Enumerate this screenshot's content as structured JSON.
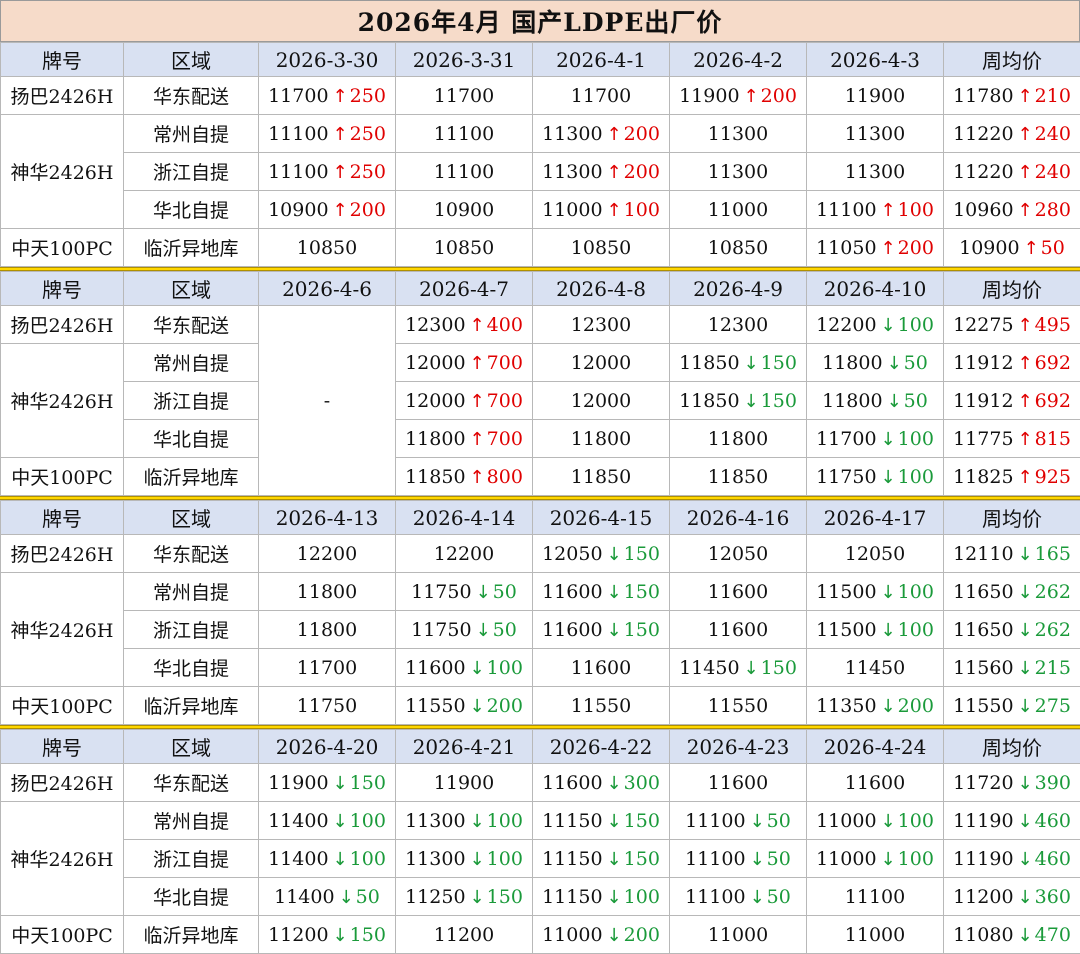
{
  "title": "2026年4月  国产LDPE出厂价",
  "colors": {
    "up": "#e00000",
    "down": "#1a9a3a",
    "header_bg": "#d9e1f2",
    "title_bg": "#f6dbc9",
    "separator": "#ffd700"
  },
  "icons": {
    "up": "arrow-up-icon",
    "down": "arrow-down-icon"
  },
  "header_labels": {
    "brand": "牌号",
    "region": "区域",
    "avg": "周均价"
  },
  "weeks": [
    {
      "dates": [
        "2026-3-30",
        "2026-3-31",
        "2026-4-1",
        "2026-4-2",
        "2026-4-3"
      ],
      "rows": [
        {
          "brand": "扬巴2426H",
          "region": "华东配送",
          "cells": [
            {
              "v": "11700",
              "dir": "up",
              "chg": "250"
            },
            {
              "v": "11700"
            },
            {
              "v": "11700"
            },
            {
              "v": "11900",
              "dir": "up",
              "chg": "200"
            },
            {
              "v": "11900"
            },
            {
              "v": "11780",
              "dir": "up",
              "chg": "210"
            }
          ]
        },
        {
          "brand": "神华2426H",
          "region": "常州自提",
          "cells": [
            {
              "v": "11100",
              "dir": "up",
              "chg": "250"
            },
            {
              "v": "11100"
            },
            {
              "v": "11300",
              "dir": "up",
              "chg": "200"
            },
            {
              "v": "11300"
            },
            {
              "v": "11300"
            },
            {
              "v": "11220",
              "dir": "up",
              "chg": "240"
            }
          ]
        },
        {
          "brand": "",
          "region": "浙江自提",
          "cells": [
            {
              "v": "11100",
              "dir": "up",
              "chg": "250"
            },
            {
              "v": "11100"
            },
            {
              "v": "11300",
              "dir": "up",
              "chg": "200"
            },
            {
              "v": "11300"
            },
            {
              "v": "11300"
            },
            {
              "v": "11220",
              "dir": "up",
              "chg": "240"
            }
          ]
        },
        {
          "brand": "",
          "region": "华北自提",
          "cells": [
            {
              "v": "10900",
              "dir": "up",
              "chg": "200"
            },
            {
              "v": "10900"
            },
            {
              "v": "11000",
              "dir": "up",
              "chg": "100"
            },
            {
              "v": "11000"
            },
            {
              "v": "11100",
              "dir": "up",
              "chg": "100"
            },
            {
              "v": "10960",
              "dir": "up",
              "chg": "280"
            }
          ]
        },
        {
          "brand": "中天100PC",
          "region": "临沂异地库",
          "cells": [
            {
              "v": "10850"
            },
            {
              "v": "10850"
            },
            {
              "v": "10850"
            },
            {
              "v": "10850"
            },
            {
              "v": "11050",
              "dir": "up",
              "chg": "200"
            },
            {
              "v": "10900",
              "dir": "up",
              "chg": "50"
            }
          ]
        }
      ]
    },
    {
      "dates": [
        "2026-4-6",
        "2026-4-7",
        "2026-4-8",
        "2026-4-9",
        "2026-4-10"
      ],
      "holiday_mark": "-",
      "rows": [
        {
          "brand": "扬巴2426H",
          "region": "华东配送",
          "cells": [
            null,
            {
              "v": "12300",
              "dir": "up",
              "chg": "400"
            },
            {
              "v": "12300"
            },
            {
              "v": "12300"
            },
            {
              "v": "12200",
              "dir": "down",
              "chg": "100"
            },
            {
              "v": "12275",
              "dir": "up",
              "chg": "495"
            }
          ]
        },
        {
          "brand": "神华2426H",
          "region": "常州自提",
          "cells": [
            null,
            {
              "v": "12000",
              "dir": "up",
              "chg": "700"
            },
            {
              "v": "12000"
            },
            {
              "v": "11850",
              "dir": "down",
              "chg": "150"
            },
            {
              "v": "11800",
              "dir": "down",
              "chg": "50"
            },
            {
              "v": "11912",
              "dir": "up",
              "chg": "692"
            }
          ]
        },
        {
          "brand": "",
          "region": "浙江自提",
          "cells": [
            null,
            {
              "v": "12000",
              "dir": "up",
              "chg": "700"
            },
            {
              "v": "12000"
            },
            {
              "v": "11850",
              "dir": "down",
              "chg": "150"
            },
            {
              "v": "11800",
              "dir": "down",
              "chg": "50"
            },
            {
              "v": "11912",
              "dir": "up",
              "chg": "692"
            }
          ]
        },
        {
          "brand": "",
          "region": "华北自提",
          "cells": [
            null,
            {
              "v": "11800",
              "dir": "up",
              "chg": "700"
            },
            {
              "v": "11800"
            },
            {
              "v": "11800"
            },
            {
              "v": "11700",
              "dir": "down",
              "chg": "100"
            },
            {
              "v": "11775",
              "dir": "up",
              "chg": "815"
            }
          ]
        },
        {
          "brand": "中天100PC",
          "region": "临沂异地库",
          "cells": [
            null,
            {
              "v": "11850",
              "dir": "up",
              "chg": "800"
            },
            {
              "v": "11850"
            },
            {
              "v": "11850"
            },
            {
              "v": "11750",
              "dir": "down",
              "chg": "100"
            },
            {
              "v": "11825",
              "dir": "up",
              "chg": "925"
            }
          ]
        }
      ]
    },
    {
      "dates": [
        "2026-4-13",
        "2026-4-14",
        "2026-4-15",
        "2026-4-16",
        "2026-4-17"
      ],
      "rows": [
        {
          "brand": "扬巴2426H",
          "region": "华东配送",
          "cells": [
            {
              "v": "12200"
            },
            {
              "v": "12200"
            },
            {
              "v": "12050",
              "dir": "down",
              "chg": "150"
            },
            {
              "v": "12050"
            },
            {
              "v": "12050"
            },
            {
              "v": "12110",
              "dir": "down",
              "chg": "165"
            }
          ]
        },
        {
          "brand": "神华2426H",
          "region": "常州自提",
          "cells": [
            {
              "v": "11800"
            },
            {
              "v": "11750",
              "dir": "down",
              "chg": "50"
            },
            {
              "v": "11600",
              "dir": "down",
              "chg": "150"
            },
            {
              "v": "11600"
            },
            {
              "v": "11500",
              "dir": "down",
              "chg": "100"
            },
            {
              "v": "11650",
              "dir": "down",
              "chg": "262"
            }
          ]
        },
        {
          "brand": "",
          "region": "浙江自提",
          "cells": [
            {
              "v": "11800"
            },
            {
              "v": "11750",
              "dir": "down",
              "chg": "50"
            },
            {
              "v": "11600",
              "dir": "down",
              "chg": "150"
            },
            {
              "v": "11600"
            },
            {
              "v": "11500",
              "dir": "down",
              "chg": "100"
            },
            {
              "v": "11650",
              "dir": "down",
              "chg": "262"
            }
          ]
        },
        {
          "brand": "",
          "region": "华北自提",
          "cells": [
            {
              "v": "11700"
            },
            {
              "v": "11600",
              "dir": "down",
              "chg": "100"
            },
            {
              "v": "11600"
            },
            {
              "v": "11450",
              "dir": "down",
              "chg": "150"
            },
            {
              "v": "11450"
            },
            {
              "v": "11560",
              "dir": "down",
              "chg": "215"
            }
          ]
        },
        {
          "brand": "中天100PC",
          "region": "临沂异地库",
          "cells": [
            {
              "v": "11750"
            },
            {
              "v": "11550",
              "dir": "down",
              "chg": "200"
            },
            {
              "v": "11550"
            },
            {
              "v": "11550"
            },
            {
              "v": "11350",
              "dir": "down",
              "chg": "200"
            },
            {
              "v": "11550",
              "dir": "down",
              "chg": "275"
            }
          ]
        }
      ]
    },
    {
      "dates": [
        "2026-4-20",
        "2026-4-21",
        "2026-4-22",
        "2026-4-23",
        "2026-4-24"
      ],
      "rows": [
        {
          "brand": "扬巴2426H",
          "region": "华东配送",
          "cells": [
            {
              "v": "11900",
              "dir": "down",
              "chg": "150"
            },
            {
              "v": "11900"
            },
            {
              "v": "11600",
              "dir": "down",
              "chg": "300"
            },
            {
              "v": "11600"
            },
            {
              "v": "11600"
            },
            {
              "v": "11720",
              "dir": "down",
              "chg": "390"
            }
          ]
        },
        {
          "brand": "神华2426H",
          "region": "常州自提",
          "cells": [
            {
              "v": "11400",
              "dir": "down",
              "chg": "100"
            },
            {
              "v": "11300",
              "dir": "down",
              "chg": "100"
            },
            {
              "v": "11150",
              "dir": "down",
              "chg": "150"
            },
            {
              "v": "11100",
              "dir": "down",
              "chg": "50"
            },
            {
              "v": "11000",
              "dir": "down",
              "chg": "100"
            },
            {
              "v": "11190",
              "dir": "down",
              "chg": "460"
            }
          ]
        },
        {
          "brand": "",
          "region": "浙江自提",
          "cells": [
            {
              "v": "11400",
              "dir": "down",
              "chg": "100"
            },
            {
              "v": "11300",
              "dir": "down",
              "chg": "100"
            },
            {
              "v": "11150",
              "dir": "down",
              "chg": "150"
            },
            {
              "v": "11100",
              "dir": "down",
              "chg": "50"
            },
            {
              "v": "11000",
              "dir": "down",
              "chg": "100"
            },
            {
              "v": "11190",
              "dir": "down",
              "chg": "460"
            }
          ]
        },
        {
          "brand": "",
          "region": "华北自提",
          "cells": [
            {
              "v": "11400",
              "dir": "down",
              "chg": "50"
            },
            {
              "v": "11250",
              "dir": "down",
              "chg": "150"
            },
            {
              "v": "11150",
              "dir": "down",
              "chg": "100"
            },
            {
              "v": "11100",
              "dir": "down",
              "chg": "50"
            },
            {
              "v": "11100"
            },
            {
              "v": "11200",
              "dir": "down",
              "chg": "360"
            }
          ]
        },
        {
          "brand": "中天100PC",
          "region": "临沂异地库",
          "cells": [
            {
              "v": "11200",
              "dir": "down",
              "chg": "150"
            },
            {
              "v": "11200"
            },
            {
              "v": "11000",
              "dir": "down",
              "chg": "200"
            },
            {
              "v": "11000"
            },
            {
              "v": "11000"
            },
            {
              "v": "11080",
              "dir": "down",
              "chg": "470"
            }
          ]
        }
      ]
    }
  ]
}
